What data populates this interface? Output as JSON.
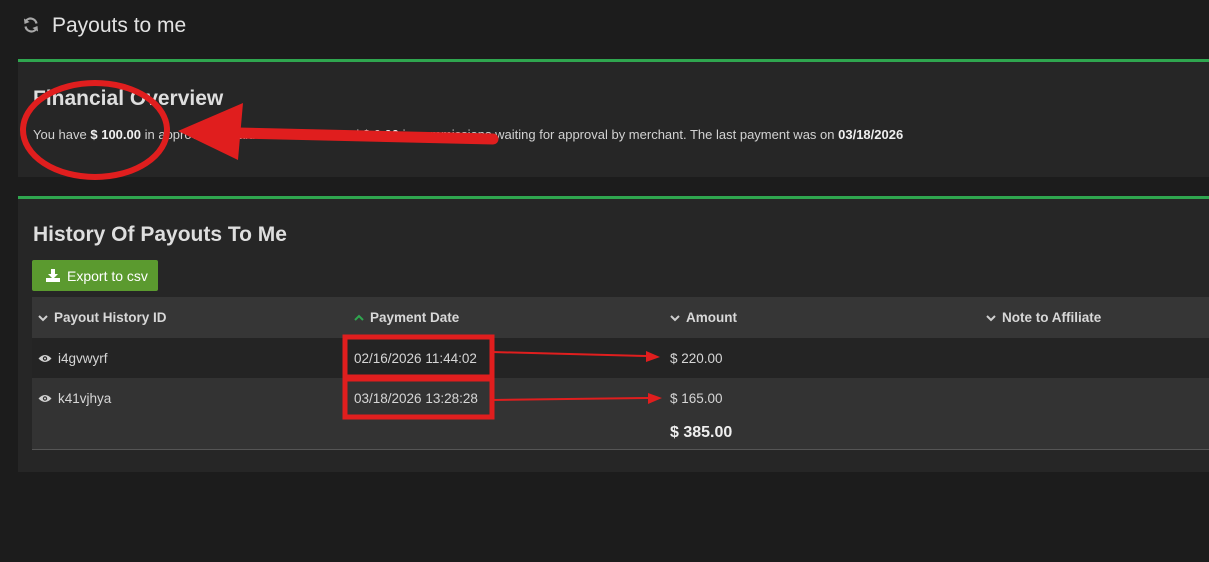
{
  "header": {
    "title": "Payouts to me",
    "icon": "refresh-icon"
  },
  "financial": {
    "title": "Financial Overview",
    "text_prefix": "You have",
    "approved_amount": "$ 100.00",
    "text_middle": "in approved unpaid commissions and",
    "pending_amount": "$ 0.00",
    "text_suffix": "in commissions waiting for approval by merchant. The last payment was on",
    "last_payment_date": "03/18/2026"
  },
  "history": {
    "title": "History Of Payouts To Me",
    "export_label": "Export to csv",
    "columns": [
      {
        "label": "Payout History ID",
        "sort": "chevron-down-icon"
      },
      {
        "label": "Payment Date",
        "sort": "chevron-up-icon"
      },
      {
        "label": "Amount",
        "sort": "chevron-down-icon"
      },
      {
        "label": "Note to Affiliate",
        "sort": "chevron-down-icon"
      }
    ],
    "rows": [
      {
        "id": "i4gvwyrf",
        "date": "02/16/2026 11:44:02",
        "amount": "$ 220.00",
        "note": ""
      },
      {
        "id": "k41vjhya",
        "date": "03/18/2026 13:28:28",
        "amount": "$ 165.00",
        "note": ""
      }
    ],
    "total": "$ 385.00"
  },
  "colors": {
    "background": "#1c1c1c",
    "panel": "#262626",
    "accent_green": "#2fa64f",
    "button_green": "#5b9a2f",
    "annotation_red": "#e01e1e"
  }
}
